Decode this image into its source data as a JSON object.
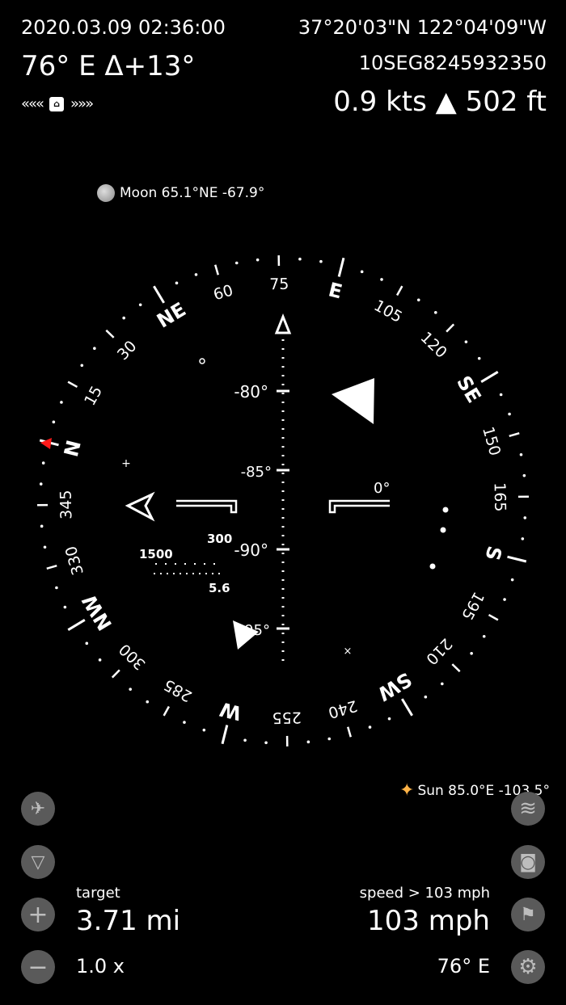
{
  "header": {
    "datetime": "2020.03.09 02:36:00",
    "coordinates": "37°20'03\"N 122°04'09\"W",
    "heading": "76° E Δ+13°",
    "mgrs": "10SEG8245932350",
    "speed_altitude": "0.9 kts ▲ 502 ft",
    "left_arrows": "«««",
    "right_arrows": "»»»",
    "lock_glyph": "⌂"
  },
  "celestial": {
    "moon": "Moon 65.1°NE -67.9°",
    "sun": "Sun 85.0°E -103.5°"
  },
  "compass": {
    "cardinals": [
      {
        "label": "N",
        "bearing": 0
      },
      {
        "label": "NE",
        "bearing": 45
      },
      {
        "label": "E",
        "bearing": 90
      },
      {
        "label": "SE",
        "bearing": 135
      },
      {
        "label": "S",
        "bearing": 180
      },
      {
        "label": "SW",
        "bearing": 225
      },
      {
        "label": "W",
        "bearing": 270
      },
      {
        "label": "NW",
        "bearing": 315
      }
    ],
    "degree_labels": [
      {
        "label": "15",
        "bearing": 15
      },
      {
        "label": "30",
        "bearing": 30
      },
      {
        "label": "60",
        "bearing": 60
      },
      {
        "label": "75",
        "bearing": 75
      },
      {
        "label": "105",
        "bearing": 105
      },
      {
        "label": "120",
        "bearing": 120
      },
      {
        "label": "150",
        "bearing": 150
      },
      {
        "label": "165",
        "bearing": 165
      },
      {
        "label": "195",
        "bearing": 195
      },
      {
        "label": "210",
        "bearing": 210
      },
      {
        "label": "240",
        "bearing": 240
      },
      {
        "label": "255",
        "bearing": 255
      },
      {
        "label": "285",
        "bearing": 285
      },
      {
        "label": "300",
        "bearing": 300
      },
      {
        "label": "330",
        "bearing": 330
      },
      {
        "label": "345",
        "bearing": 345
      }
    ],
    "heading_bearing": 76,
    "pitch_labels": [
      "-80°",
      "-85°",
      "-90°",
      "-95°"
    ],
    "roll_label": "0°",
    "range_labels": {
      "left": "1500",
      "right": "300",
      "bottom": "5.6"
    }
  },
  "controls": {
    "target_label": "target",
    "target_value": "3.71 mi",
    "zoom_value": "1.0 x",
    "speed_label": "speed > 103 mph",
    "speed_value": "103 mph",
    "bearing_value": "76° E"
  },
  "icons": {
    "satellite": "✈",
    "wifi": "▽",
    "plus": "+",
    "minus": "−",
    "layers": "≋",
    "camera": "◙",
    "flag": "⚑",
    "gear": "⚙"
  },
  "colors": {
    "background": "#000000",
    "text": "#ffffff",
    "button": "#5a5a5a",
    "north_marker": "#ff1a1a",
    "sun": "#ffb347"
  }
}
